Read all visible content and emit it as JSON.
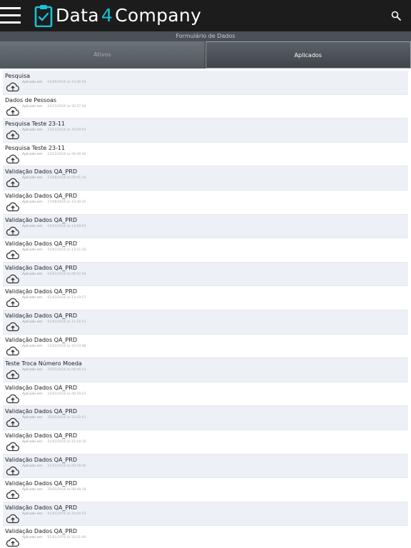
{
  "app": {
    "brand_left": "Data",
    "brand_num": "4",
    "brand_right": "Company",
    "accent_color": "#16c3d8"
  },
  "subtitle": "Formulário de Dados",
  "tabs": [
    {
      "label": "Ativos",
      "active": false
    },
    {
      "label": "Aplicados",
      "active": true
    }
  ],
  "rows": [
    {
      "title": "Pesquisa",
      "meta_label": "Aplicado em:",
      "date": "02/06/2016 às 15:46:58"
    },
    {
      "title": "Dados de Pessoas",
      "meta_label": "Aplicado em:",
      "date": "24/11/2016 às 20:57:34"
    },
    {
      "title": "Pesquisa Teste 23-11",
      "meta_label": "Aplicado em:",
      "date": "23/11/2016 às 10:09:55"
    },
    {
      "title": "Pesquisa Teste 23-11",
      "meta_label": "Aplicado em:",
      "date": "23/11/2016 às 09:40:34"
    },
    {
      "title": "Validação Dados QA_PRD",
      "meta_label": "Aplicado em:",
      "date": "17/08/2016 às 09:41:14"
    },
    {
      "title": "Validação Dados QA_PRD",
      "meta_label": "Aplicado em:",
      "date": "27/08/2016 às 15:40:35"
    },
    {
      "title": "Validação Dados QA_PRD",
      "meta_label": "Aplicado em:",
      "date": "03/03/2016 às 14:09:03"
    },
    {
      "title": "Validação Dados QA_PRD",
      "meta_label": "Aplicado em:",
      "date": "03/03/2016 às 13:51:26"
    },
    {
      "title": "Validação Dados QA_PRD",
      "meta_label": "Aplicado em:",
      "date": "03/03/2016 às 08:52:48"
    },
    {
      "title": "Validação Dados QA_PRD",
      "meta_label": "Aplicado em:",
      "date": "01/03/2016 às 13:19:57"
    },
    {
      "title": "Validação Dados QA_PRD",
      "meta_label": "Aplicado em:",
      "date": "01/03/2016 às 11:16:51"
    },
    {
      "title": "Validação Dados QA_PRD",
      "meta_label": "Aplicado em:",
      "date": "15/02/2016 às 20:24:08"
    },
    {
      "title": "Teste Troca Número Moeda",
      "meta_label": "Aplicado em:",
      "date": "25/01/2016 às 08:46:53"
    },
    {
      "title": "Validação Dados QA_PRD",
      "meta_label": "Aplicado em:",
      "date": "22/01/2016 às 08:59:22"
    },
    {
      "title": "Validação Dados QA_PRD",
      "meta_label": "Aplicado em:",
      "date": "22/01/2016 às 23:52:41"
    },
    {
      "title": "Validação Dados QA_PRD",
      "meta_label": "Aplicado em:",
      "date": "21/01/2016 às 15:18:30"
    },
    {
      "title": "Validação Dados QA_PRD",
      "meta_label": "Aplicado em:",
      "date": "21/01/2016 às 09:56:46"
    },
    {
      "title": "Validação Dados QA_PRD",
      "meta_label": "Aplicado em:",
      "date": "20/01/2016 às 09:08:28"
    },
    {
      "title": "Validação Dados QA_PRD",
      "meta_label": "Aplicado em:",
      "date": "01/01/1970 às 20:20:22"
    },
    {
      "title": "Validação Dados QA_PRD",
      "meta_label": "Aplicado em:",
      "date": "01/01/1970 às 20:31:40"
    }
  ]
}
